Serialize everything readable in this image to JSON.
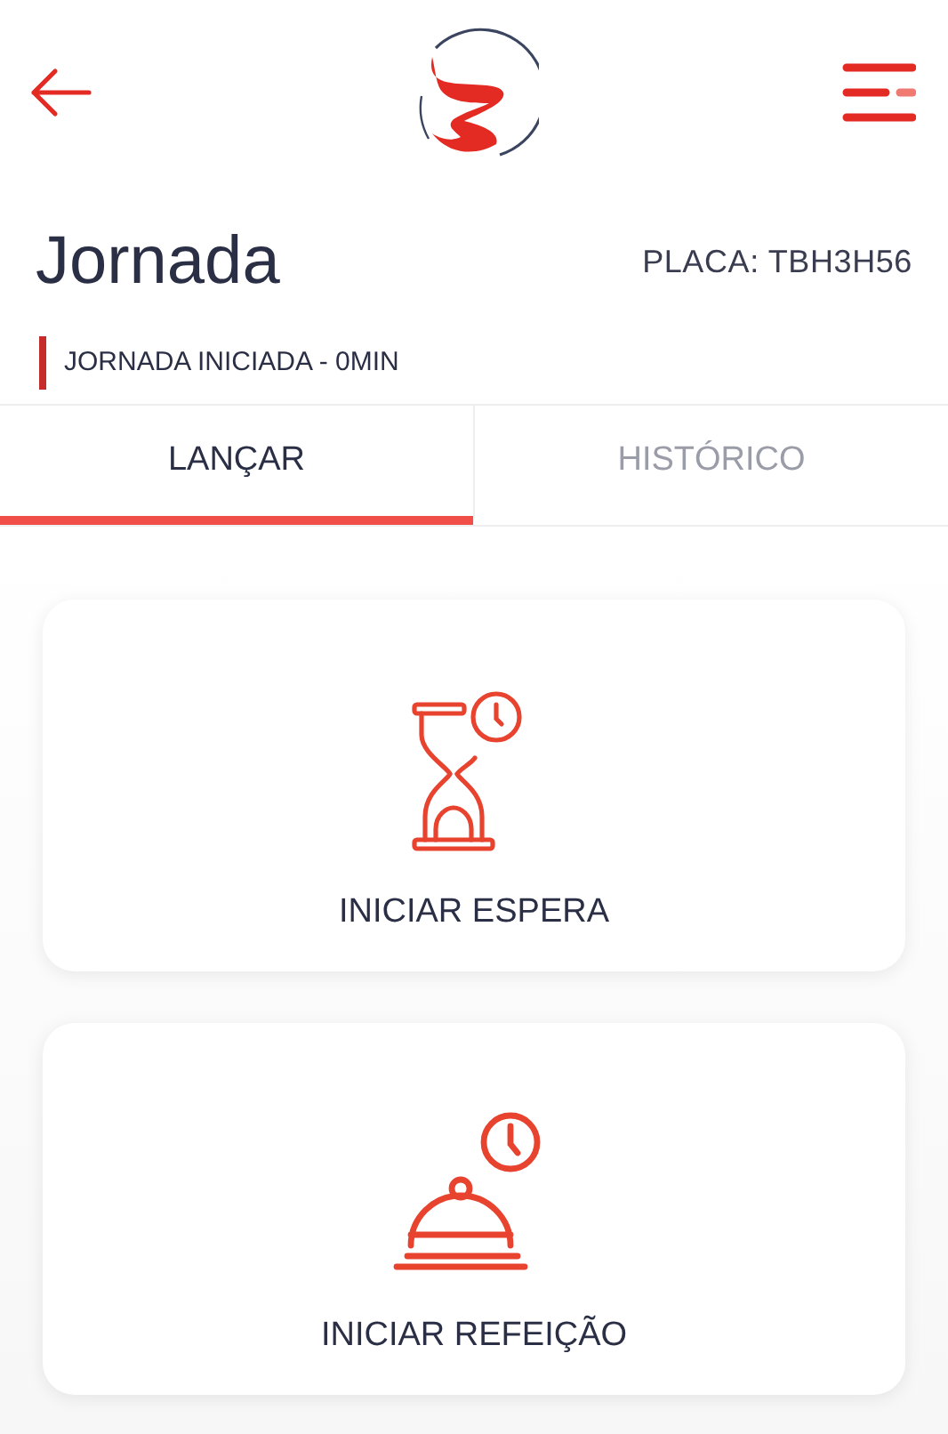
{
  "header": {
    "title": "Jornada",
    "plate": "PLACA: TBH3H56",
    "status": "JORNADA INICIADA - 0MIN"
  },
  "tabs": [
    {
      "label": "LANÇAR",
      "selected": true
    },
    {
      "label": "HISTÓRICO",
      "selected": false
    }
  ],
  "actions": [
    {
      "kind": "wait",
      "label": "INICIAR ESPERA"
    },
    {
      "kind": "meal",
      "label": "INICIAR REFEIÇÃO"
    }
  ]
}
